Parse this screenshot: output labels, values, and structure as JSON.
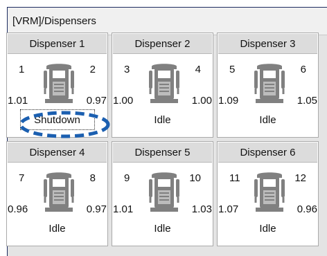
{
  "window": {
    "title": "[VRM]/Dispensers"
  },
  "dispensers": [
    {
      "name": "Dispenser 1",
      "pump_left": "1",
      "pump_right": "2",
      "vol_left": "1.01",
      "vol_right": "0.97",
      "status": "Shutdown"
    },
    {
      "name": "Dispenser 2",
      "pump_left": "3",
      "pump_right": "4",
      "vol_left": "1.00",
      "vol_right": "1.00",
      "status": "Idle"
    },
    {
      "name": "Dispenser 3",
      "pump_left": "5",
      "pump_right": "6",
      "vol_left": "1.09",
      "vol_right": "1.05",
      "status": "Idle"
    },
    {
      "name": "Dispenser 4",
      "pump_left": "7",
      "pump_right": "8",
      "vol_left": "0.96",
      "vol_right": "0.97",
      "status": "Idle"
    },
    {
      "name": "Dispenser 5",
      "pump_left": "9",
      "pump_right": "10",
      "vol_left": "1.01",
      "vol_right": "1.03",
      "status": "Idle"
    },
    {
      "name": "Dispenser 6",
      "pump_left": "11",
      "pump_right": "12",
      "vol_left": "1.07",
      "vol_right": "0.96",
      "status": "Idle"
    }
  ],
  "colors": {
    "annotation": "#1b5fb0",
    "pump_icon": "#808080"
  }
}
